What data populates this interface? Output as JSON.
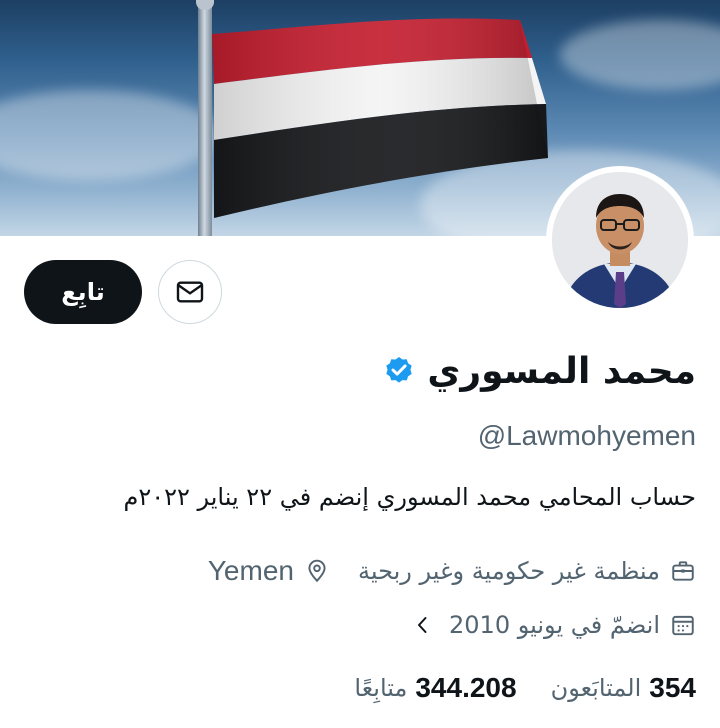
{
  "profile": {
    "name": "محمد المسوري",
    "handle": "@Lawmohyemen",
    "bio": "حساب المحامي محمد المسوري  إنضم في ٢٢ يناير ٢٠٢٢م",
    "category": "منظمة غير حكومية وغير ربحية",
    "location": "Yemen",
    "joined": "انضمّ في يونيو 2010",
    "verified": true
  },
  "actions": {
    "follow_label": "تابِع"
  },
  "stats": {
    "following_count": "354",
    "following_label": "المتابَعون",
    "followers_count": "344.208",
    "followers_label": "متابِعًا"
  },
  "icons": {
    "message": "envelope-icon",
    "verified": "verified-badge-icon",
    "category": "briefcase-icon",
    "location": "location-pin-icon",
    "joined": "calendar-icon",
    "more": "chevron-left-icon"
  },
  "colors": {
    "text_primary": "#0f1419",
    "text_secondary": "#536471",
    "verified_blue": "#1d9bf0",
    "button_dark": "#0f1419",
    "flag_red": "#ce1126",
    "flag_white": "#ffffff",
    "flag_black": "#000000"
  }
}
